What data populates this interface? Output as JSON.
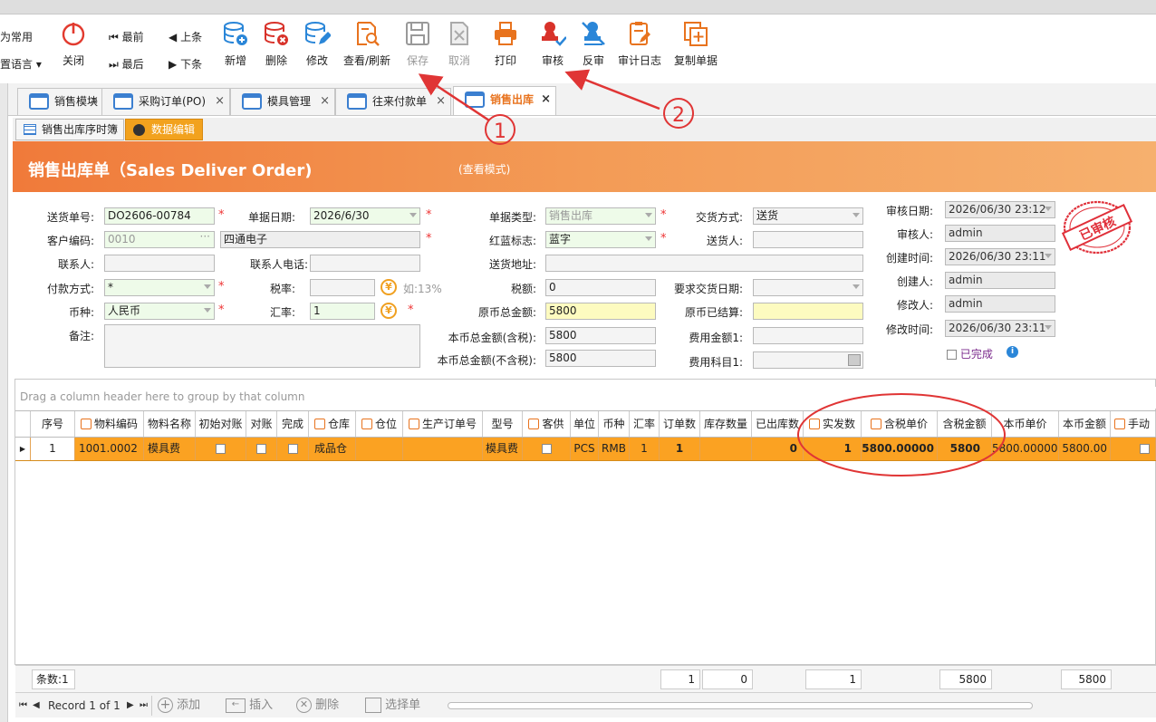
{
  "ribbon": {
    "left_items": [
      {
        "label": "为常用"
      },
      {
        "label": "置语言"
      }
    ],
    "close": "关闭",
    "nav": {
      "first": "最前",
      "prev": "上条",
      "last": "最后",
      "next": "下条"
    },
    "buttons": [
      {
        "label": "新增",
        "icon": "db-add-icon"
      },
      {
        "label": "删除",
        "icon": "db-delete-icon"
      },
      {
        "label": "修改",
        "icon": "db-edit-icon"
      },
      {
        "label": "查看/刷新",
        "icon": "doc-search-icon"
      },
      {
        "label": "保存",
        "icon": "save-icon"
      },
      {
        "label": "取消",
        "icon": "cancel-icon"
      },
      {
        "label": "打印",
        "icon": "printer-icon"
      },
      {
        "label": "审核",
        "icon": "approve-stamp-icon"
      },
      {
        "label": "反审",
        "icon": "unapprove-stamp-icon"
      },
      {
        "label": "审计日志",
        "icon": "audit-log-icon"
      },
      {
        "label": "复制单据",
        "icon": "copy-doc-icon"
      }
    ]
  },
  "tabs": [
    {
      "label": "销售模块"
    },
    {
      "label": "采购订单(PO)"
    },
    {
      "label": "模具管理"
    },
    {
      "label": "往来付款单"
    },
    {
      "label": "销售出库"
    }
  ],
  "subtabs": [
    {
      "label": "销售出库序时簿"
    },
    {
      "label": "数据编辑"
    }
  ],
  "banner": {
    "title": "销售出库单（Sales Deliver Order)",
    "mode": "(查看模式)"
  },
  "form": {
    "delivery_no_label": "送货单号:",
    "delivery_no": "DO2606-00784",
    "doc_date_label": "单据日期:",
    "doc_date": "2026/6/30",
    "doc_type_label": "单据类型:",
    "doc_type": "销售出库",
    "trade_method_label": "交货方式:",
    "trade_method": "送货",
    "customer_code_label": "客户编码:",
    "customer_code": "0010",
    "customer_name": "四通电子",
    "red_blue_label": "红蓝标志:",
    "red_blue": "蓝字",
    "deliverer_label": "送货人:",
    "contact_label": "联系人:",
    "contact_phone_label": "联系人电话:",
    "address_label": "送货地址:",
    "payment_label": "付款方式:",
    "payment": "*",
    "tax_rate_label": "税率:",
    "tax_rate_hint": "如:13%",
    "tax_amount_label": "税额:",
    "tax_amount": "0",
    "required_date_label": "要求交货日期:",
    "currency_label": "币种:",
    "currency": "人民币",
    "exchange_label": "汇率:",
    "exchange": "1",
    "orig_total_label": "原币总金额:",
    "orig_total": "5800",
    "orig_settled_label": "原币已结算:",
    "remark_label": "备注:",
    "local_total_tax_label": "本币总金额(含税):",
    "local_total_tax": "5800",
    "fee_amount_label": "费用金额1:",
    "local_total_notax_label": "本币总金额(不含税):",
    "local_total_notax": "5800",
    "fee_subject_label": "费用科目1:"
  },
  "audit": {
    "audit_date_label": "审核日期:",
    "audit_date": "2026/06/30 23:12",
    "auditor_label": "审核人:",
    "auditor": "admin",
    "created_label": "创建时间:",
    "created": "2026/06/30 23:11",
    "creator_label": "创建人:",
    "creator": "admin",
    "modifier_label": "修改人:",
    "modifier": "admin",
    "modified_label": "修改时间:",
    "modified": "2026/06/30 23:11",
    "completed_label": "已完成",
    "stamp_text": "已审核"
  },
  "grid": {
    "group_hint": "Drag a column header here to group by that column",
    "columns": [
      "序号",
      "物料编码",
      "物料名称",
      "初始对账",
      "对账",
      "完成",
      "仓库",
      "仓位",
      "生产订单号",
      "型号",
      "客供",
      "单位",
      "币种",
      "汇率",
      "订单数",
      "库存数量",
      "已出库数",
      "实发数",
      "含税单价",
      "含税金额",
      "本币单价",
      "本币金额",
      "手动"
    ],
    "row": {
      "seq": "1",
      "code": "1001.0002",
      "name": "模具费",
      "warehouse": "成品仓",
      "model": "模具费",
      "unit": "PCS",
      "currency": "RMB",
      "rate": "1",
      "order_qty": "1",
      "shipped": "0",
      "actual": "1",
      "unit_price": "5800.00000",
      "amount": "5800",
      "local_price": "5800.00000",
      "local_amount": "5800.00"
    },
    "footer": {
      "count": "条数:1",
      "order_qty": "1",
      "stock": "0",
      "actual": "1",
      "amount": "5800",
      "local_amount": "5800"
    }
  },
  "navbar": {
    "record": "Record 1 of 1",
    "add": "添加",
    "insert": "插入",
    "delete": "删除",
    "select": "选择单"
  },
  "annotations": {
    "one": "1",
    "two": "2"
  }
}
